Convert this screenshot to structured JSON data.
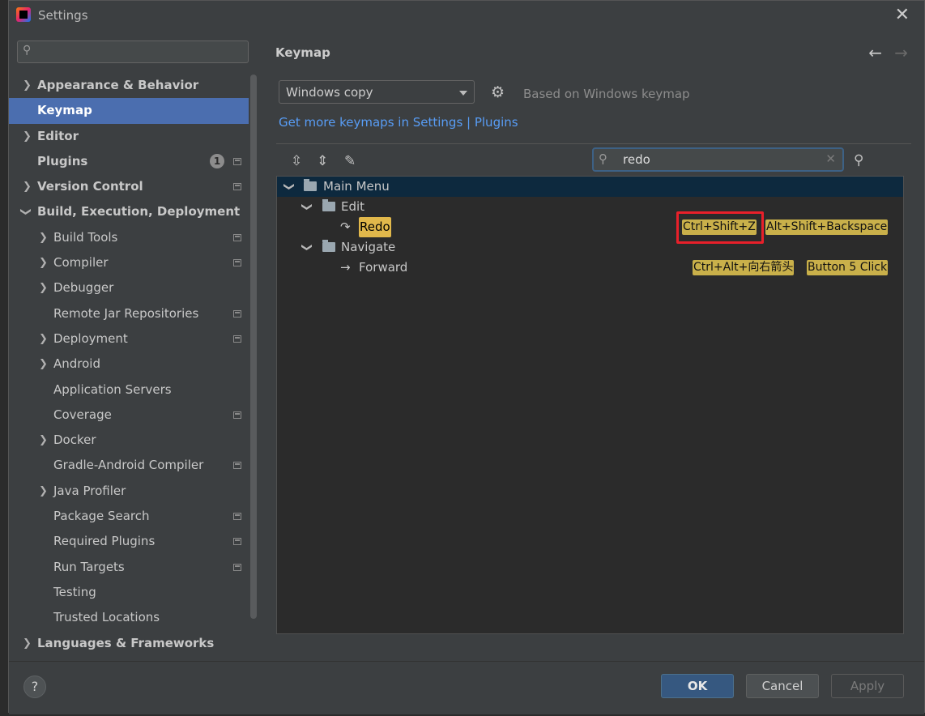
{
  "window": {
    "title": "Settings"
  },
  "sidebar": {
    "search_placeholder": "",
    "items": [
      {
        "label": "Appearance & Behavior"
      },
      {
        "label": "Keymap"
      },
      {
        "label": "Editor"
      },
      {
        "label": "Plugins",
        "badge": "1"
      },
      {
        "label": "Version Control"
      },
      {
        "label": "Build, Execution, Deployment"
      },
      {
        "label": "Build Tools"
      },
      {
        "label": "Compiler"
      },
      {
        "label": "Debugger"
      },
      {
        "label": "Remote Jar Repositories"
      },
      {
        "label": "Deployment"
      },
      {
        "label": "Android"
      },
      {
        "label": "Application Servers"
      },
      {
        "label": "Coverage"
      },
      {
        "label": "Docker"
      },
      {
        "label": "Gradle-Android Compiler"
      },
      {
        "label": "Java Profiler"
      },
      {
        "label": "Package Search"
      },
      {
        "label": "Required Plugins"
      },
      {
        "label": "Run Targets"
      },
      {
        "label": "Testing"
      },
      {
        "label": "Trusted Locations"
      },
      {
        "label": "Languages & Frameworks"
      }
    ]
  },
  "main": {
    "heading": "Keymap",
    "keymap_selected": "Windows copy",
    "based_on": "Based on Windows keymap",
    "link": "Get more keymaps in Settings | Plugins",
    "search_value": "redo",
    "tree": {
      "main_menu": "Main Menu",
      "edit": "Edit",
      "redo": "Redo",
      "redo_shortcuts": [
        "Ctrl+Shift+Z",
        "Alt+Shift+Backspace"
      ],
      "navigate": "Navigate",
      "forward": "Forward",
      "forward_shortcuts": [
        "Ctrl+Alt+向右箭头",
        "Button 5 Click"
      ]
    }
  },
  "footer": {
    "help": "?",
    "ok": "OK",
    "cancel": "Cancel",
    "apply": "Apply"
  },
  "colors": {
    "selection": "#4b6eaf",
    "highlight": "#e1b84b",
    "shortcut_bg": "#c9b04a",
    "link": "#589df6",
    "annotation_box": "#e8202a"
  }
}
